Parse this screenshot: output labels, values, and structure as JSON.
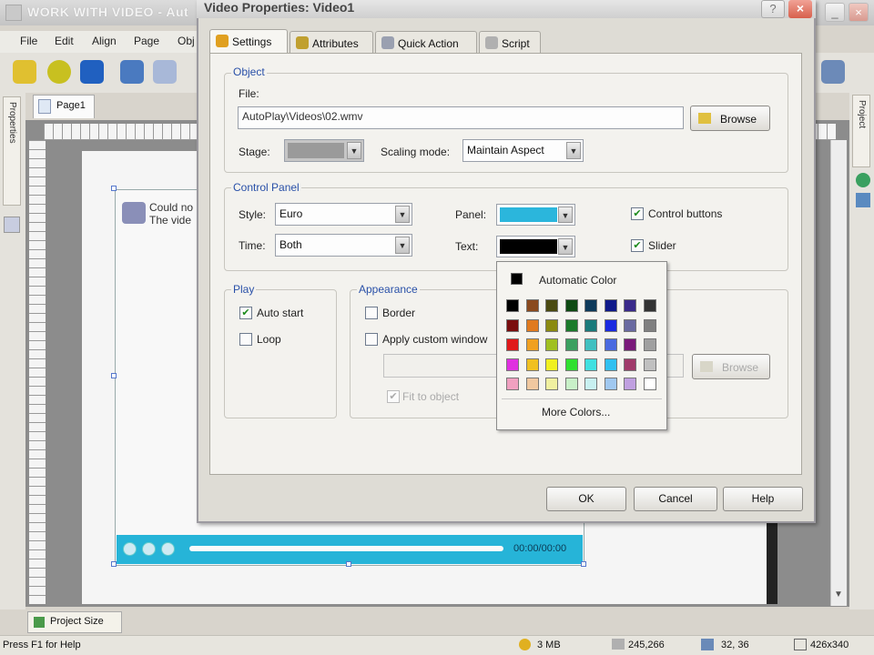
{
  "app": {
    "title": "WORK WITH VIDEO - Aut",
    "menu": [
      "File",
      "Edit",
      "Align",
      "Page",
      "Obj"
    ],
    "page_tab": "Page1",
    "left_panel_tab": "Properties",
    "right_panel_tab": "Project",
    "project_size_tab": "Project Size",
    "video_error_line1": "Could no",
    "video_error_line2": "The vide",
    "video_time": "00:00/00:00"
  },
  "status": {
    "help": "Press F1 for Help",
    "size": "3 MB",
    "coords": "245,266",
    "position": "32, 36",
    "dimensions": "426x340"
  },
  "dialog": {
    "title": "Video Properties: Video1",
    "help_label": "?",
    "close_label": "×",
    "tabs": [
      {
        "label": "Settings",
        "icon": "settings-icon"
      },
      {
        "label": "Attributes",
        "icon": "attributes-icon"
      },
      {
        "label": "Quick Action",
        "icon": "quick-action-icon"
      },
      {
        "label": "Script",
        "icon": "script-icon"
      }
    ],
    "object": {
      "group_label": "Object",
      "file_label": "File:",
      "file_value": "AutoPlay\\Videos\\02.wmv",
      "browse": "Browse",
      "stage_label": "Stage:",
      "scaling_label": "Scaling mode:",
      "scaling_value": "Maintain Aspect"
    },
    "control_panel": {
      "group_label": "Control Panel",
      "style_label": "Style:",
      "style_value": "Euro",
      "time_label": "Time:",
      "time_value": "Both",
      "panel_label": "Panel:",
      "panel_color": "#2bb6dc",
      "text_label": "Text:",
      "text_color": "#000000",
      "control_buttons": "Control buttons",
      "control_buttons_checked": true,
      "slider": "Slider",
      "slider_checked": true
    },
    "play": {
      "group_label": "Play",
      "auto_start": "Auto start",
      "auto_start_checked": true,
      "loop": "Loop",
      "loop_checked": false
    },
    "appearance": {
      "group_label": "Appearance",
      "border": "Border",
      "apply_custom": "Apply custom window",
      "fit_to_object": "Fit to object",
      "browse": "Browse"
    },
    "color_palette": {
      "automatic": "Automatic Color",
      "more": "More Colors...",
      "rows": [
        [
          "#000000",
          "#8a4a1e",
          "#4a4a10",
          "#0e4a12",
          "#0e3a5a",
          "#101a8a",
          "#3a2a8a",
          "#333333"
        ],
        [
          "#7a0e0e",
          "#e07a1e",
          "#8a8a10",
          "#1a7a2a",
          "#1a7a7a",
          "#1a2ae0",
          "#6a6aa0",
          "#808080"
        ],
        [
          "#e01a1a",
          "#f0a020",
          "#a0c020",
          "#3aa060",
          "#40c0c0",
          "#4a6ae0",
          "#7a1a7a",
          "#a0a0a0"
        ],
        [
          "#e030e0",
          "#f0c020",
          "#f0f020",
          "#30e030",
          "#40e0e0",
          "#30c0f0",
          "#a03a6a",
          "#c0c0c0"
        ],
        [
          "#f0a0c0",
          "#f0c8a0",
          "#f0f0a0",
          "#c8f0c8",
          "#c8f0f0",
          "#a0c8f0",
          "#c0a0e0",
          "#ffffff"
        ]
      ]
    },
    "buttons": {
      "ok": "OK",
      "cancel": "Cancel",
      "help": "Help"
    }
  }
}
